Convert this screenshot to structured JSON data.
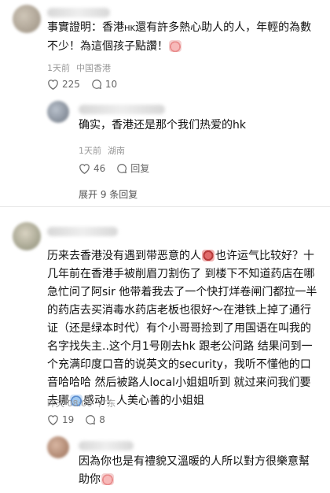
{
  "comments": [
    {
      "text_a": "事實證明：香港",
      "text_hk": "HK",
      "text_b": "還有許多熱心助人的人，年輕的為數不少！為這個孩子點讚！",
      "time": "1天前",
      "location": "中国香港",
      "likes": "225",
      "replies": "10"
    },
    {
      "text_a": "确实，香港还是那个我们热爱的hk",
      "time": "1天前",
      "location": "湖南",
      "likes": "46",
      "reply_label": "回复"
    },
    {
      "expand_label": "展开 9 条回复"
    },
    {
      "text_1": "历来去香港没有遇到带恶意的人",
      "text_2": "也许运气比较好？十几年前在香港手被削眉刀割伤了 到楼下不知道药店在哪 急忙问了阿sir 他带着我去了一个快打烊卷闸门都拉一半的药店去买消毒水药店老板也很好～在港铁上掉了通行证（还是绿本时代）有个小哥哥捡到了用国语在叫我的名字找失主..这个月1号刚去hk 跟老公问路 结果问到一个充满印度口音的说英文的security，我听不懂他的口音哈哈哈 然后被路人local小姐姐听到 就过来问我们要去哪",
      "text_3": "感动！人美心善的小姐姐",
      "time": "昨天 08:06",
      "location": "广东",
      "likes": "19",
      "replies": "8"
    },
    {
      "text_a": "因為你也是有禮貌又溫暖的人所以對方很樂意幫助你"
    }
  ]
}
